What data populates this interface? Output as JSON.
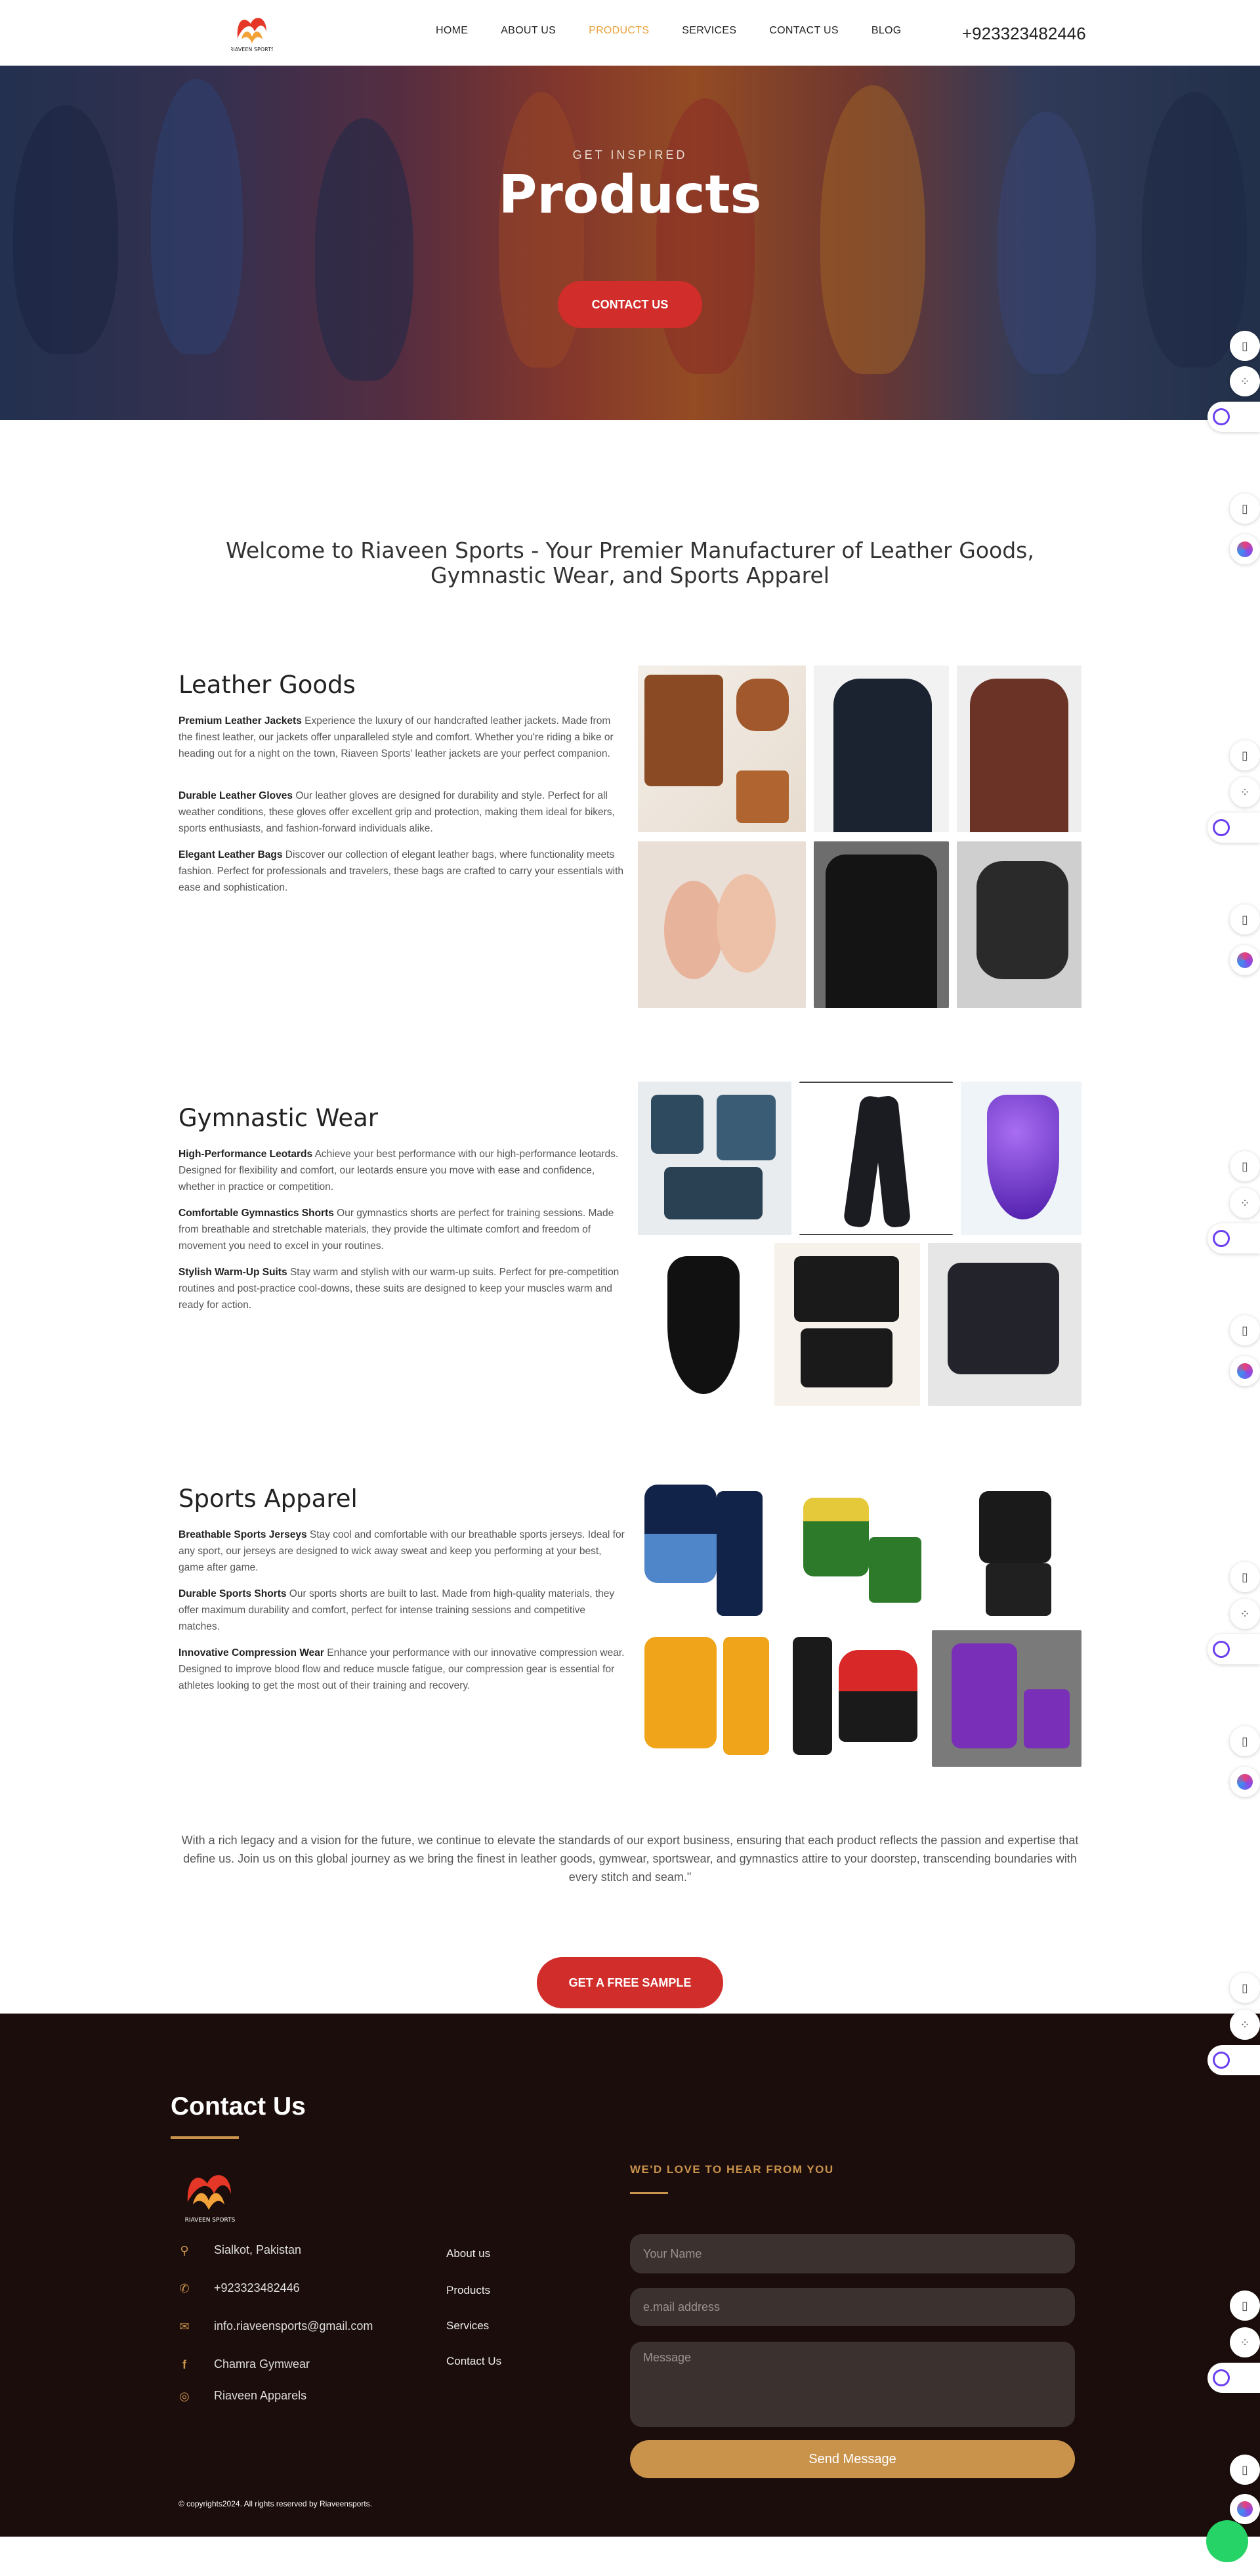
{
  "header": {
    "brand_name": "RIAVEEN SPORTS",
    "nav": [
      "HOME",
      "ABOUT US",
      "PRODUCTS",
      "SERVICES",
      "CONTACT US",
      "BLOG"
    ],
    "active_nav": "PRODUCTS",
    "phone": "+923323482446"
  },
  "hero": {
    "kicker": "GET INSPIRED",
    "title": "Products",
    "button": "CONTACT US"
  },
  "welcome": "Welcome to Riaveen Sports - Your Premier Manufacturer of Leather Goods, Gymnastic Wear, and Sports Apparel",
  "sections": [
    {
      "title": "Leather Goods",
      "items": [
        {
          "name": "Premium Leather Jackets",
          "text": " Experience the luxury of our handcrafted leather jackets. Made from the finest leather, our jackets offer unparalleled style and comfort. Whether you're riding a bike or heading out for a night on the town, Riaveen Sports' leather jackets are your perfect companion."
        },
        {
          "name": "Durable Leather Gloves",
          "text": " Our leather gloves are designed for durability and style. Perfect for all weather conditions, these gloves offer excellent grip and protection, making them ideal for bikers, sports enthusiasts, and fashion-forward individuals alike."
        },
        {
          "name": "Elegant Leather Bags",
          "text": " Discover our collection of elegant leather bags, where functionality meets fashion. Perfect for professionals and travelers, these bags are crafted to carry your essentials with ease and sophistication."
        }
      ]
    },
    {
      "title": "Gymnastic Wear",
      "items": [
        {
          "name": "High-Performance Leotards",
          "text": " Achieve your best performance with our high-performance leotards. Designed for flexibility and comfort, our leotards ensure you move with ease and confidence, whether in practice or competition."
        },
        {
          "name": "Comfortable Gymnastics Shorts",
          "text": " Our gymnastics shorts are perfect for training sessions. Made from breathable and stretchable materials, they provide the ultimate comfort and freedom of movement you need to excel in your routines."
        },
        {
          "name": "Stylish Warm-Up Suits",
          "text": " Stay warm and stylish with our warm-up suits. Perfect for pre-competition routines and post-practice cool-downs, these suits are designed to keep your muscles warm and ready for action."
        }
      ]
    },
    {
      "title": "Sports Apparel",
      "items": [
        {
          "name": "Breathable Sports Jerseys",
          "text": " Stay cool and comfortable with our breathable sports jerseys. Ideal for any sport, our jerseys are designed to wick away sweat and keep you performing at your best, game after game."
        },
        {
          "name": "Durable Sports Shorts",
          "text": " Our sports shorts are built to last. Made from high-quality materials, they offer maximum durability and comfort, perfect for intense training sessions and competitive matches."
        },
        {
          "name": "Innovative Compression Wear",
          "text": " Enhance your performance with our innovative compression wear. Designed to improve blood flow and reduce muscle fatigue, our compression gear is essential for athletes looking to get the most out of their training and recovery."
        }
      ]
    }
  ],
  "legacy": "With a rich legacy and a vision for the future, we continue to elevate the standards of our export business, ensuring that each product reflects the passion and expertise that define us. Join us on this global journey as we bring the finest in leather goods, gymwear, sportswear, and gymnastics attire to your doorstep, transcending boundaries with every stitch and seam.\"",
  "sample_button": "GET A FREE SAMPLE",
  "footer": {
    "title": "Contact Us",
    "contacts": [
      {
        "icon": "map-pin-icon",
        "text": "Sialkot, Pakistan"
      },
      {
        "icon": "phone-icon",
        "text": "+923323482446"
      },
      {
        "icon": "mail-icon",
        "text": "info.riaveensports@gmail.com"
      },
      {
        "icon": "facebook-icon",
        "text": "Chamra Gymwear"
      },
      {
        "icon": "instagram-icon",
        "text": "Riaveen Apparels"
      }
    ],
    "links": [
      "About us",
      "Products",
      "Services",
      "Contact Us"
    ],
    "form_kicker": "WE'D LOVE TO HEAR FROM YOU",
    "name_placeholder": "Your Name",
    "email_placeholder": "e.mail address",
    "message_placeholder": "Message",
    "send": "Send Message",
    "copyright": "© copyrights2024.  All rights reserved by Riaveensports."
  },
  "colors": {
    "accent": "#e9a23b",
    "red": "#d12d2a",
    "gold": "#c9934c",
    "footer_bg": "#1b0d0b"
  }
}
